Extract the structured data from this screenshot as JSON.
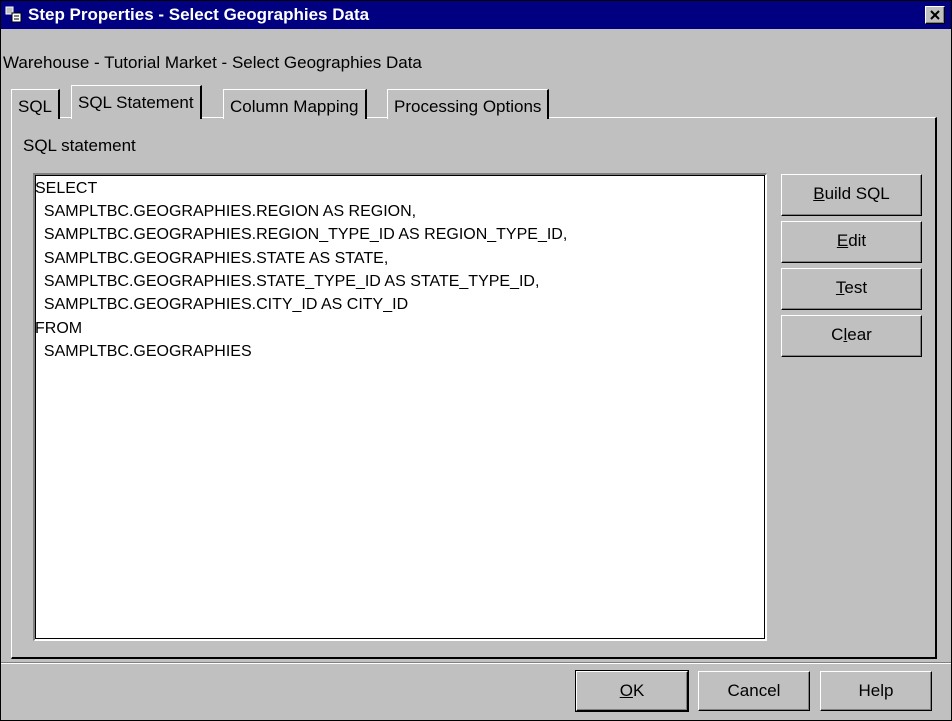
{
  "window": {
    "title": "Step Properties - Select Geographies Data",
    "subtitle": "Warehouse - Tutorial Market - Select Geographies Data"
  },
  "tabs": [
    {
      "label": "SQL"
    },
    {
      "label": "SQL Statement",
      "active": true
    },
    {
      "label": "Column Mapping"
    },
    {
      "label": "Processing Options"
    }
  ],
  "panel": {
    "label": "SQL statement",
    "sql_lines": [
      "SELECT",
      "  SAMPLTBC.GEOGRAPHIES.REGION AS REGION,",
      "  SAMPLTBC.GEOGRAPHIES.REGION_TYPE_ID AS REGION_TYPE_ID,",
      "  SAMPLTBC.GEOGRAPHIES.STATE AS STATE,",
      "  SAMPLTBC.GEOGRAPHIES.STATE_TYPE_ID AS STATE_TYPE_ID,",
      "  SAMPLTBC.GEOGRAPHIES.CITY_ID AS CITY_ID",
      "FROM",
      "  SAMPLTBC.GEOGRAPHIES"
    ]
  },
  "side_buttons": {
    "build_sql": {
      "mnemonic": "B",
      "rest": "uild SQL"
    },
    "edit": {
      "mnemonic": "E",
      "rest": "dit"
    },
    "test": {
      "mnemonic": "T",
      "rest": "est"
    },
    "clear": {
      "pre": "C",
      "mnemonic": "l",
      "rest": "ear"
    }
  },
  "bottom_buttons": {
    "ok": {
      "mnemonic": "O",
      "rest": "K"
    },
    "cancel": "Cancel",
    "help": "Help"
  },
  "icons": {
    "app": "step-properties-icon",
    "close": "close-icon"
  }
}
